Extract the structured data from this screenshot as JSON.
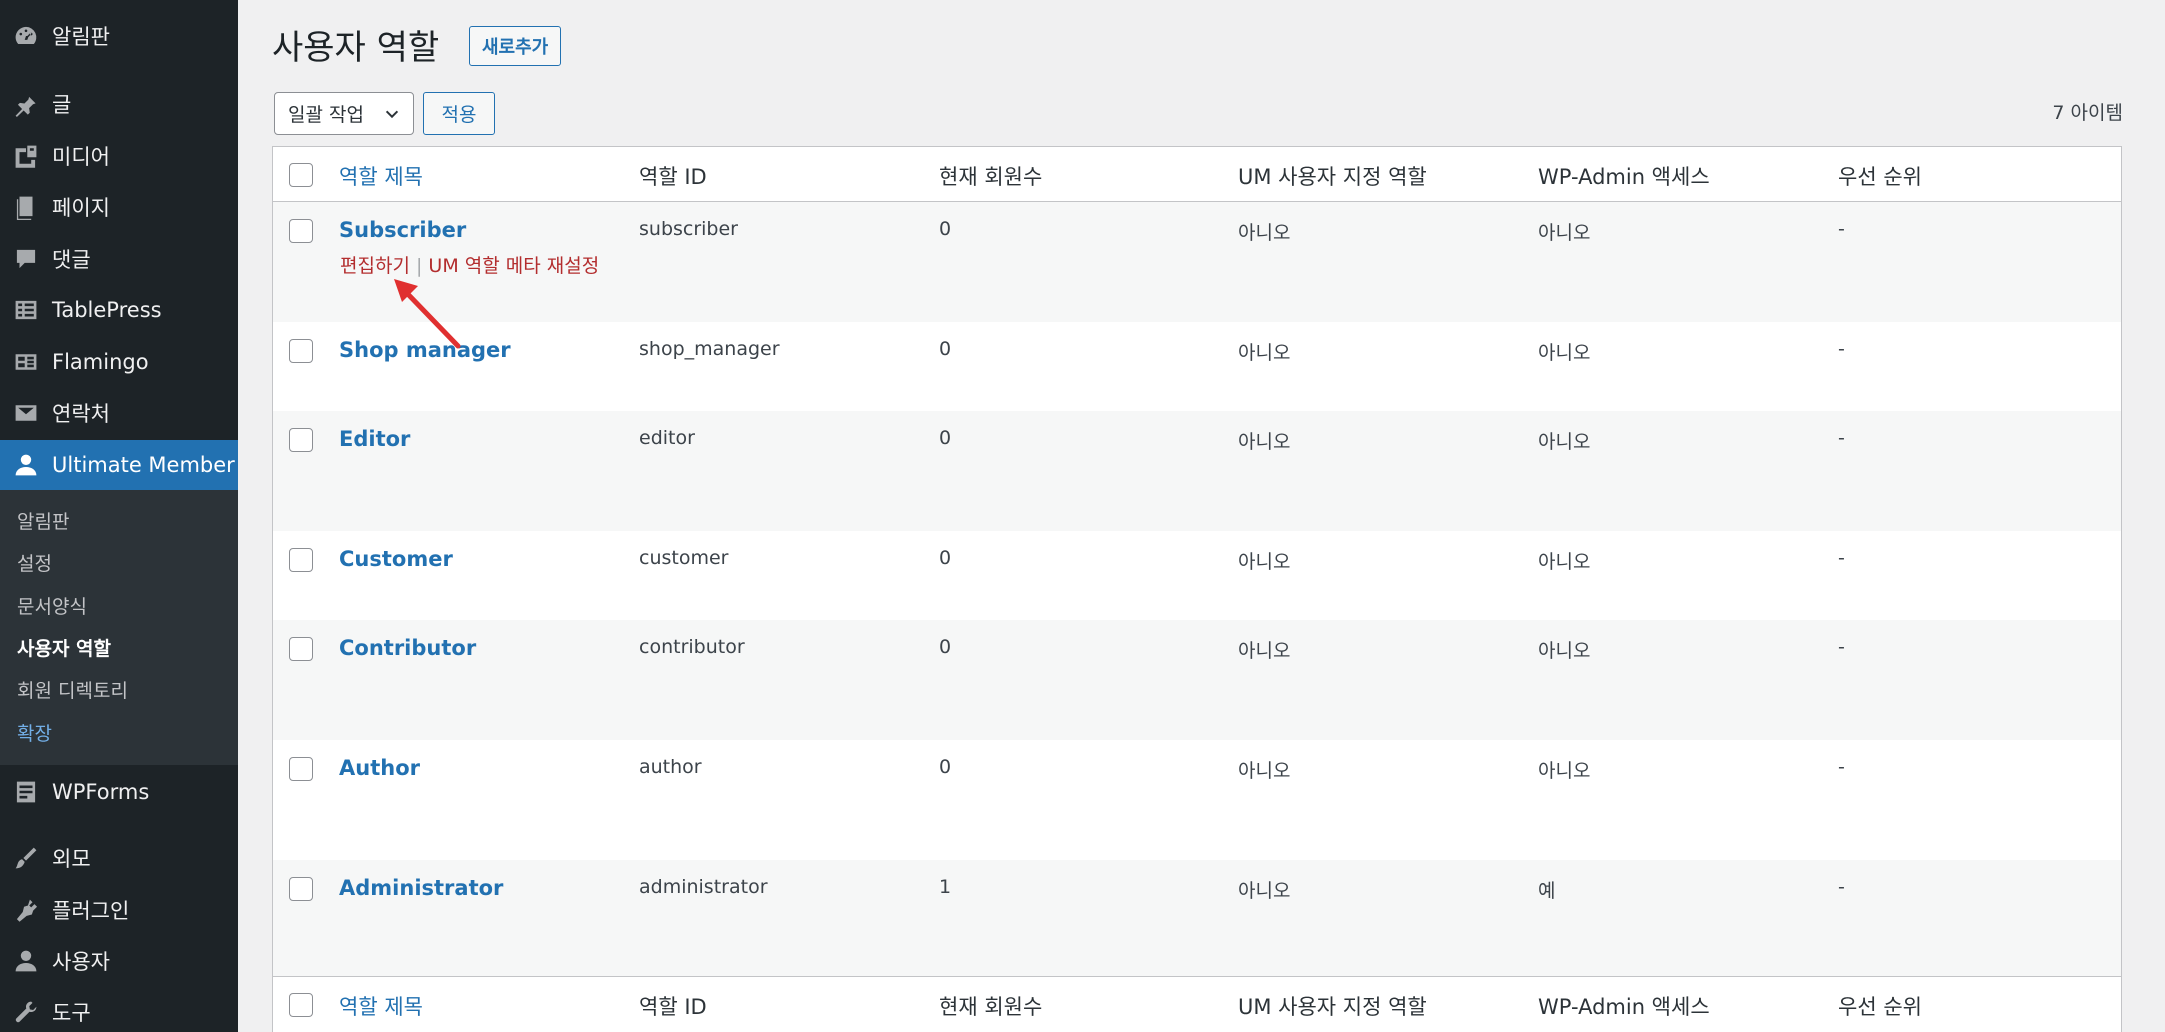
{
  "sidebar": {
    "items": [
      {
        "label": "알림판",
        "icon": "dashboard-icon"
      },
      {
        "label": "글",
        "icon": "pin-icon"
      },
      {
        "label": "미디어",
        "icon": "media-icon"
      },
      {
        "label": "페이지",
        "icon": "page-icon"
      },
      {
        "label": "댓글",
        "icon": "comment-icon"
      },
      {
        "label": "TablePress",
        "icon": "table-icon"
      },
      {
        "label": "Flamingo",
        "icon": "flamingo-icon"
      },
      {
        "label": "연락처",
        "icon": "mail-icon"
      },
      {
        "label": "Ultimate Member",
        "icon": "user-icon"
      },
      {
        "label": "WPForms",
        "icon": "forms-icon"
      },
      {
        "label": "외모",
        "icon": "brush-icon"
      },
      {
        "label": "플러그인",
        "icon": "plugin-icon"
      },
      {
        "label": "사용자",
        "icon": "users-icon"
      },
      {
        "label": "도구",
        "icon": "wrench-icon"
      }
    ],
    "submenu": [
      "알림판",
      "설정",
      "문서양식",
      "사용자 역할",
      "회원 디렉토리",
      "확장"
    ]
  },
  "header": {
    "title": "사용자 역할",
    "add_new": "새로추가"
  },
  "toolbar": {
    "bulk_action": "일괄 작업",
    "apply": "적용",
    "item_count": "7 아이템"
  },
  "columns": [
    "역할 제목",
    "역할 ID",
    "현재 회원수",
    "UM 사용자 지정 역할",
    "WP-Admin 액세스",
    "우선 순위"
  ],
  "row_actions": {
    "edit": "편집하기",
    "separator": "|",
    "reset": "UM 역할 메타 재설정"
  },
  "rows": [
    {
      "title": "Subscriber",
      "id": "subscriber",
      "members": "0",
      "um_custom": "아니오",
      "wp_admin": "아니오",
      "priority": "-"
    },
    {
      "title": "Shop manager",
      "id": "shop_manager",
      "members": "0",
      "um_custom": "아니오",
      "wp_admin": "아니오",
      "priority": "-"
    },
    {
      "title": "Editor",
      "id": "editor",
      "members": "0",
      "um_custom": "아니오",
      "wp_admin": "아니오",
      "priority": "-"
    },
    {
      "title": "Customer",
      "id": "customer",
      "members": "0",
      "um_custom": "아니오",
      "wp_admin": "아니오",
      "priority": "-"
    },
    {
      "title": "Contributor",
      "id": "contributor",
      "members": "0",
      "um_custom": "아니오",
      "wp_admin": "아니오",
      "priority": "-"
    },
    {
      "title": "Author",
      "id": "author",
      "members": "0",
      "um_custom": "아니오",
      "wp_admin": "아니오",
      "priority": "-"
    },
    {
      "title": "Administrator",
      "id": "administrator",
      "members": "1",
      "um_custom": "아니오",
      "wp_admin": "예",
      "priority": "-"
    }
  ],
  "colors": {
    "sidebar_bg": "#1d2327",
    "accent": "#2271b1",
    "link_danger": "#b32d2e",
    "annotation_arrow": "#e03030"
  }
}
